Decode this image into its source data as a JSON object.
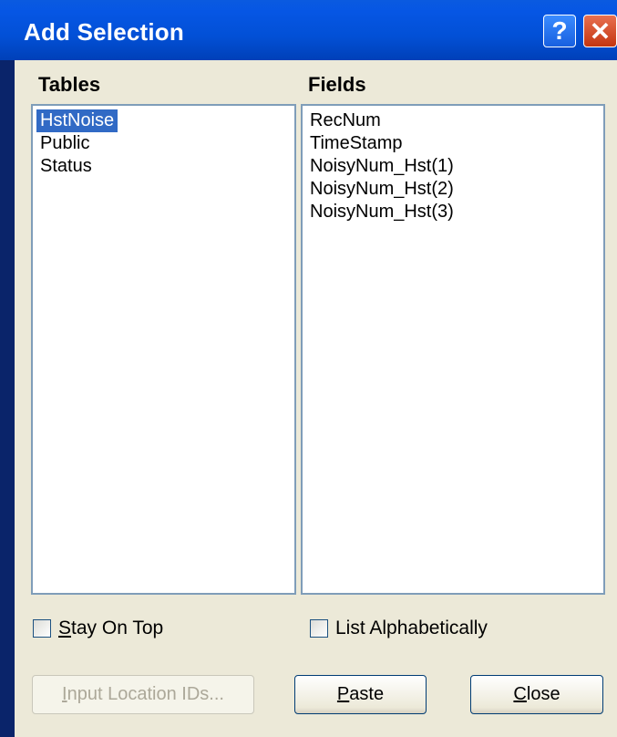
{
  "dialog": {
    "title": "Add Selection",
    "help_glyph": "?",
    "close_glyph": "✕"
  },
  "tables": {
    "label": "Tables",
    "items": [
      "HstNoise",
      "Public",
      "Status"
    ],
    "selected_index": 0
  },
  "fields": {
    "label": "Fields",
    "items": [
      "RecNum",
      "TimeStamp",
      "NoisyNum_Hst(1)",
      "NoisyNum_Hst(2)",
      "NoisyNum_Hst(3)"
    ]
  },
  "options": {
    "stay_on_top": {
      "mnemonic": "S",
      "rest": "tay On Top",
      "checked": false
    },
    "list_alpha": {
      "label": "List Alphabetically",
      "checked": false
    }
  },
  "buttons": {
    "input_location_ids": {
      "mnemonic": "I",
      "rest": "nput Location IDs...",
      "enabled": false
    },
    "paste": {
      "mnemonic": "P",
      "rest": "aste"
    },
    "close": {
      "mnemonic": "C",
      "rest": "lose"
    }
  },
  "colors": {
    "title_bar": "#0250d6",
    "selection": "#316ac5",
    "dialog_face": "#ece9d8"
  }
}
